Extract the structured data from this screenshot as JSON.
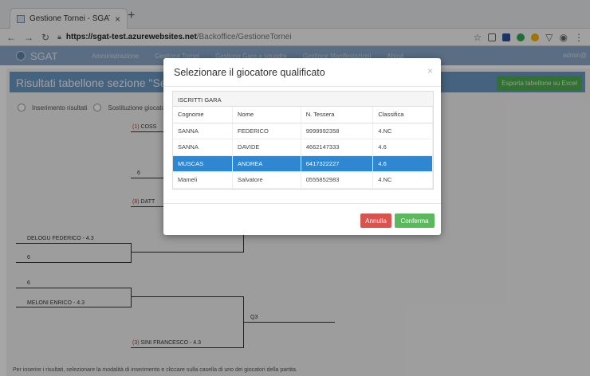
{
  "browser": {
    "tab_title": "Gestione Tornei - SGAT",
    "tab_close": "×",
    "new_tab": "+",
    "url_host": "https://sgat-test.azurewebsites.net",
    "url_path": "/Backoffice/GestioneTornei"
  },
  "navbar": {
    "brand": "SGAT",
    "items": [
      "Amministrazione",
      "Gestione Tornei",
      "Gestione Gare a squadre",
      "Gestione Manifestazioni",
      "About"
    ],
    "user": "admin@"
  },
  "page": {
    "title": "Risultati tabellone sezione \"Sezio",
    "export_label": "Esporta tabellone su Excel",
    "radio_insert": "Inserimento risultati",
    "radio_replace": "Sostituzione giocato",
    "footer_note": "Per inserire i risultati, selezionare la modalità di inserimento e cliccare sulla casella di uno dei giocatori della partita."
  },
  "bracket": {
    "labels": [
      {
        "seed": "(1)",
        "name": "COSS"
      },
      {
        "seed": "(8)",
        "name": "DATT"
      },
      {
        "seed": "",
        "name": "DELOGU FEDERICO - 4.3"
      },
      {
        "seed": "",
        "name": "MELONI ENRICO - 4.3"
      },
      {
        "seed": "(3)",
        "name": "SINI FRANCESCO - 4.3"
      }
    ],
    "scores": [
      "6",
      "6",
      "6",
      "Q3"
    ]
  },
  "modal": {
    "title": "Selezionare il giocatore qualificato",
    "close": "×",
    "panel_heading": "ISCRITTI GARA",
    "columns": [
      "Cognome",
      "Nome",
      "N. Tessera",
      "Classifica"
    ],
    "rows": [
      [
        "SANNA",
        "FEDERICO",
        "9999992358",
        "4.NC"
      ],
      [
        "SANNA",
        "DAVIDE",
        "4662147333",
        "4.6"
      ],
      [
        "MUSCAS",
        "ANDREA",
        "6417322227",
        "4.6"
      ],
      [
        "Mameli",
        "Salvatore",
        "0555852983",
        "4.NC"
      ]
    ],
    "selected_row": 2,
    "cancel_label": "Annulla",
    "confirm_label": "Conferma"
  },
  "colors": {
    "navbar": "#8aa8c8",
    "selected_row": "#2f86d1",
    "cancel": "#d9534f",
    "confirm": "#5cb85c"
  }
}
